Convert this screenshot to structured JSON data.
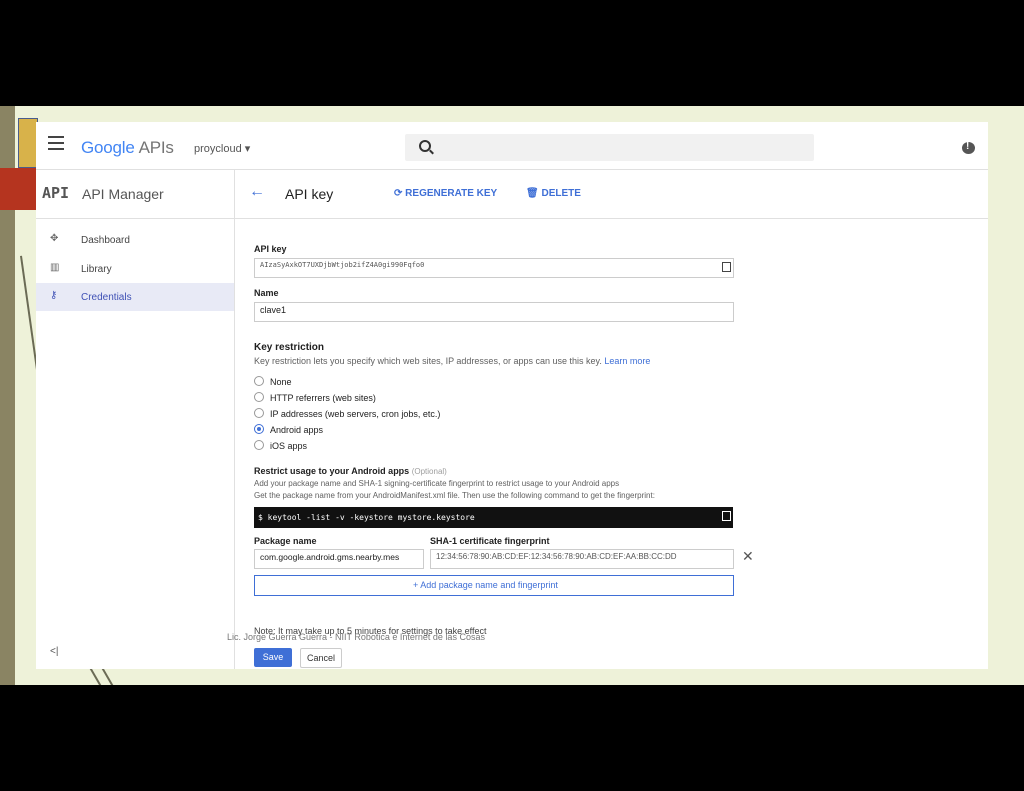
{
  "topbar": {
    "logo_google": "Google",
    "logo_apis": "APIs",
    "project": "proycloud ▾"
  },
  "sidebar": {
    "api_mark": "API",
    "title": "API Manager",
    "items": [
      {
        "label": "Dashboard",
        "icon": "dashboard-icon"
      },
      {
        "label": "Library",
        "icon": "library-icon"
      },
      {
        "label": "Credentials",
        "icon": "key-icon"
      }
    ],
    "collapse": "<|"
  },
  "header": {
    "back": "←",
    "title": "API key",
    "regenerate": "REGENERATE KEY",
    "delete": "DELETE"
  },
  "form": {
    "api_key_label": "API key",
    "api_key_value": "AIzaSyAxkOT7UXDjbWtjob2ifZ4A0gi990Fqfo0",
    "name_label": "Name",
    "name_value": "clave1",
    "restriction_title": "Key restriction",
    "restriction_desc": "Key restriction lets you specify which web sites, IP addresses, or apps can use this key.",
    "learn_more": "Learn more",
    "options": [
      {
        "label": "None",
        "selected": false
      },
      {
        "label": "HTTP referrers (web sites)",
        "selected": false
      },
      {
        "label": "IP addresses (web servers, cron jobs, etc.)",
        "selected": false
      },
      {
        "label": "Android apps",
        "selected": true
      },
      {
        "label": "iOS apps",
        "selected": false
      }
    ],
    "android_title": "Restrict usage to your Android apps",
    "optional": "(Optional)",
    "android_desc1": "Add your package name and SHA-1 signing-certificate fingerprint to restrict usage to your Android apps",
    "android_desc2": "Get the package name from your AndroidManifest.xml file. Then use the following command to get the fingerprint:",
    "command": "$ keytool -list -v -keystore mystore.keystore",
    "package_label": "Package name",
    "sha_label": "SHA-1 certificate fingerprint",
    "package_value": "com.google.android.gms.nearby.mes",
    "sha_value": "12:34:56:78:90:AB:CD:EF:12:34:56:78:90:AB:CD:EF:AA:BB:CC:DD",
    "add_label": "+ Add package name and fingerprint",
    "note": "Note: It may take up to 5 minutes for settings to take effect",
    "save": "Save",
    "cancel": "Cancel"
  },
  "footer": "Lic. Jorge Guerra Guerra - NIIT Robotica e Internet de las Cosas",
  "colors": {
    "accent": "#3f6fd6",
    "slide_bg": "#eef2d9",
    "active_nav": "#e8eaf6"
  }
}
